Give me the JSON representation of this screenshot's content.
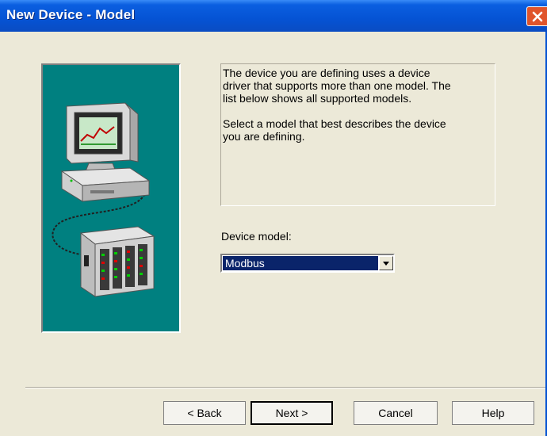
{
  "window": {
    "title": "New Device - Model"
  },
  "description": {
    "line1": "The device you are defining uses a device",
    "line2": "driver that supports more than one model.  The",
    "line3": "list below shows all supported models.",
    "line4": "Select  a model that best describes the device",
    "line5": "you are defining."
  },
  "model": {
    "label": "Device model:",
    "selected": "Modbus"
  },
  "buttons": {
    "back": "< Back",
    "next": "Next >",
    "cancel": "Cancel",
    "help": "Help"
  },
  "colors": {
    "title_bar": "#0553D4",
    "dialog_bg": "#ECE9D8",
    "illustration_bg": "#008080",
    "selection": "#0A246A",
    "close_button": "#E0542B"
  },
  "icons": {
    "close": "close-icon",
    "dropdown": "chevron-down-icon",
    "illustration": "computer-plc-illustration"
  }
}
